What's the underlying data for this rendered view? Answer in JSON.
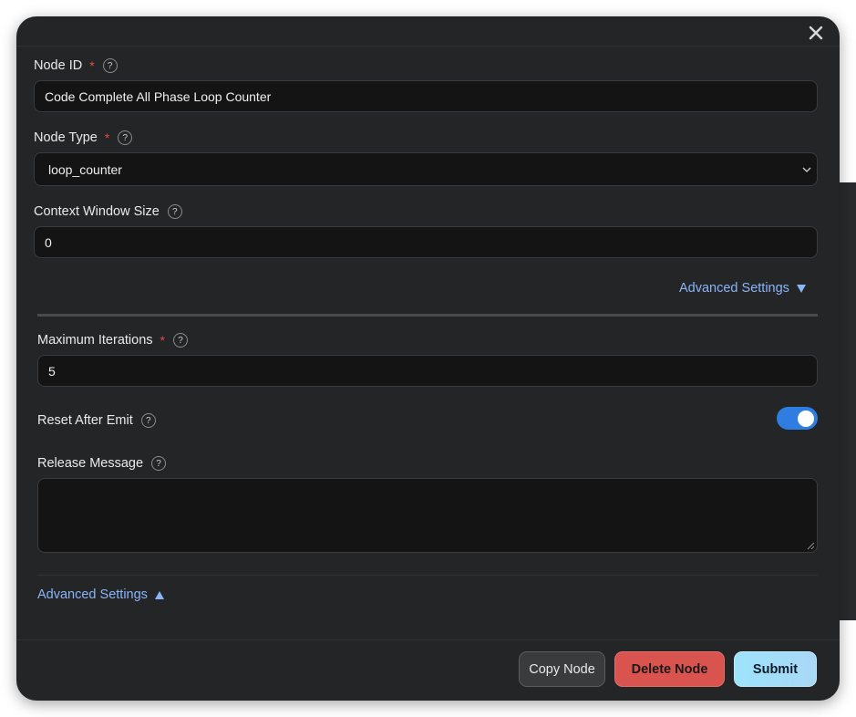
{
  "dialog": {
    "close_icon": "close-icon"
  },
  "fields": {
    "node_id": {
      "label": "Node ID",
      "required": "*",
      "value": "Code Complete All Phase Loop Counter"
    },
    "node_type": {
      "label": "Node Type",
      "required": "*",
      "value": "loop_counter"
    },
    "context_window": {
      "label": "Context Window Size",
      "value": "0"
    },
    "max_iterations": {
      "label": "Maximum Iterations",
      "required": "*",
      "value": "5"
    },
    "reset_after_emit": {
      "label": "Reset After Emit",
      "enabled": true
    },
    "release_message": {
      "label": "Release Message",
      "value": ""
    }
  },
  "help_glyph": "?",
  "advanced_settings_top": "Advanced Settings",
  "advanced_settings_bottom": "Advanced Settings",
  "footer": {
    "copy_label": "Copy Node",
    "delete_label": "Delete Node",
    "submit_label": "Submit"
  },
  "colors": {
    "accent_link": "#8ab4f8",
    "toggle_on": "#2f7de1",
    "delete": "#d9534f",
    "submit": "#9ee3fb",
    "required": "#e5484d"
  }
}
